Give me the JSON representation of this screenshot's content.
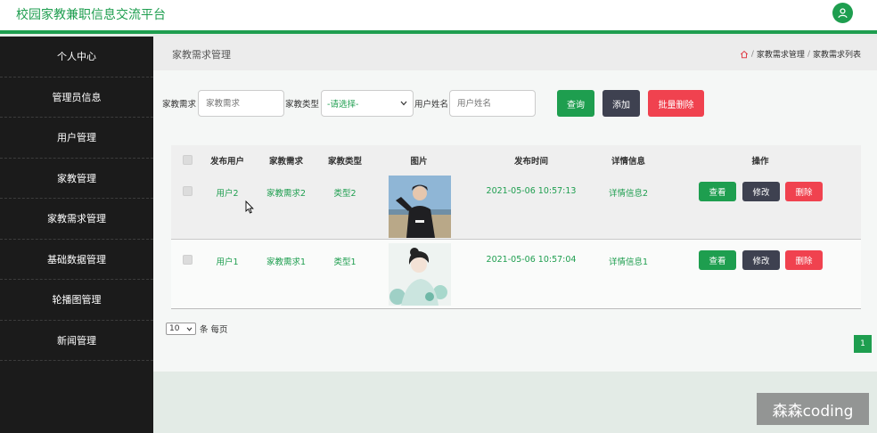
{
  "app": {
    "title": "校园家教兼职信息交流平台"
  },
  "sidebar": {
    "items": [
      {
        "label": "个人中心"
      },
      {
        "label": "管理员信息"
      },
      {
        "label": "用户管理"
      },
      {
        "label": "家教管理"
      },
      {
        "label": "家教需求管理"
      },
      {
        "label": "基础数据管理"
      },
      {
        "label": "轮播图管理"
      },
      {
        "label": "新闻管理"
      }
    ]
  },
  "header": {
    "title": "家教需求管理",
    "breadcrumb": [
      "家教需求管理",
      "家教需求列表"
    ],
    "breadcrumb_sep": "/"
  },
  "search": {
    "need_label": "家教需求",
    "need_placeholder": "家教需求",
    "type_label": "家教类型",
    "type_selected": "-请选择-",
    "username_label": "用户姓名",
    "username_placeholder": "用户姓名",
    "query_label": "查询",
    "add_label": "添加",
    "batch_delete_label": "批量删除"
  },
  "table": {
    "headers": [
      "发布用户",
      "家教需求",
      "家教类型",
      "图片",
      "发布时间",
      "详情信息",
      "操作"
    ],
    "rows": [
      {
        "user": "用户2",
        "need": "家教需求2",
        "type": "类型2",
        "time": "2021-05-06 10:57:13",
        "detail": "详情信息2",
        "photo": "photo-man-coast"
      },
      {
        "user": "用户1",
        "need": "家教需求1",
        "type": "类型1",
        "time": "2021-05-06 10:57:04",
        "detail": "详情信息1",
        "photo": "photo-woman-floral"
      }
    ],
    "actions": {
      "view": "查看",
      "edit": "修改",
      "delete": "删除"
    }
  },
  "pager": {
    "page_size": "10",
    "per_page_text": "条 每页",
    "current_page": "1"
  },
  "overlay": {
    "watermark": "森森coding"
  },
  "colors": {
    "primary": "#1e9e4f",
    "dark_button": "#3e4150",
    "danger": "#f0424f",
    "sidebar_bg": "#1b1b1b"
  },
  "icons": {
    "user": "user-icon",
    "home": "home-icon",
    "select_arrow": "chevron-down-icon",
    "pointer": "mouse-pointer-icon"
  }
}
